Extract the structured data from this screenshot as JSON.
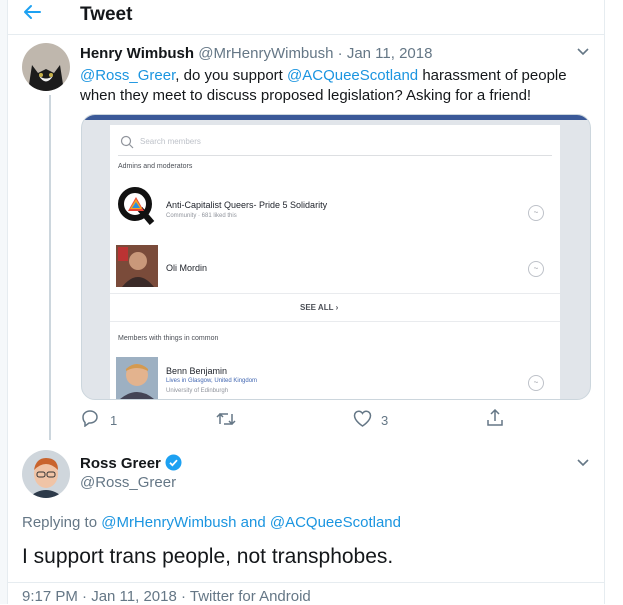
{
  "header": {
    "title": "Tweet"
  },
  "tweet1": {
    "name": "Henry Wimbush",
    "handle": "@MrHenryWimbush",
    "sep": "·",
    "date": "Jan 11, 2018",
    "mention1": "@Ross_Greer",
    "text1": ", do you support ",
    "mention2": "@ACQueeScotland",
    "text2": " harassment of people",
    "line2": "when they meet to discuss proposed legislation? Asking for a friend!",
    "actions": {
      "reply_count": "1",
      "like_count": "3"
    }
  },
  "embed": {
    "search_placeholder": "Search members",
    "section1": "Admins and moderators",
    "group_name": "Anti-Capitalist Queers- Pride 5 Solidarity",
    "group_sub": "Community · 681 liked this",
    "member1": "Oli Mordin",
    "see_all": "SEE ALL ›",
    "section2": "Members with things in common",
    "member2": "Benn Benjamin",
    "member2_loc": "Lives in Glasgow, United Kingdom",
    "member2_edu": "University of Edinburgh"
  },
  "tweet2": {
    "name": "Ross Greer",
    "handle": "@Ross_Greer",
    "replying_prefix": "Replying to ",
    "replying_to1": "@MrHenryWimbush",
    "replying_and": " and ",
    "replying_to2": "@ACQueeScotland",
    "text": "I support trans people, not transphobes.",
    "meta": "9:17 PM · Jan 11, 2018 · Twitter for Android"
  },
  "colors": {
    "accent": "#1da1f2",
    "link": "#1b95e0",
    "muted": "#657786"
  }
}
